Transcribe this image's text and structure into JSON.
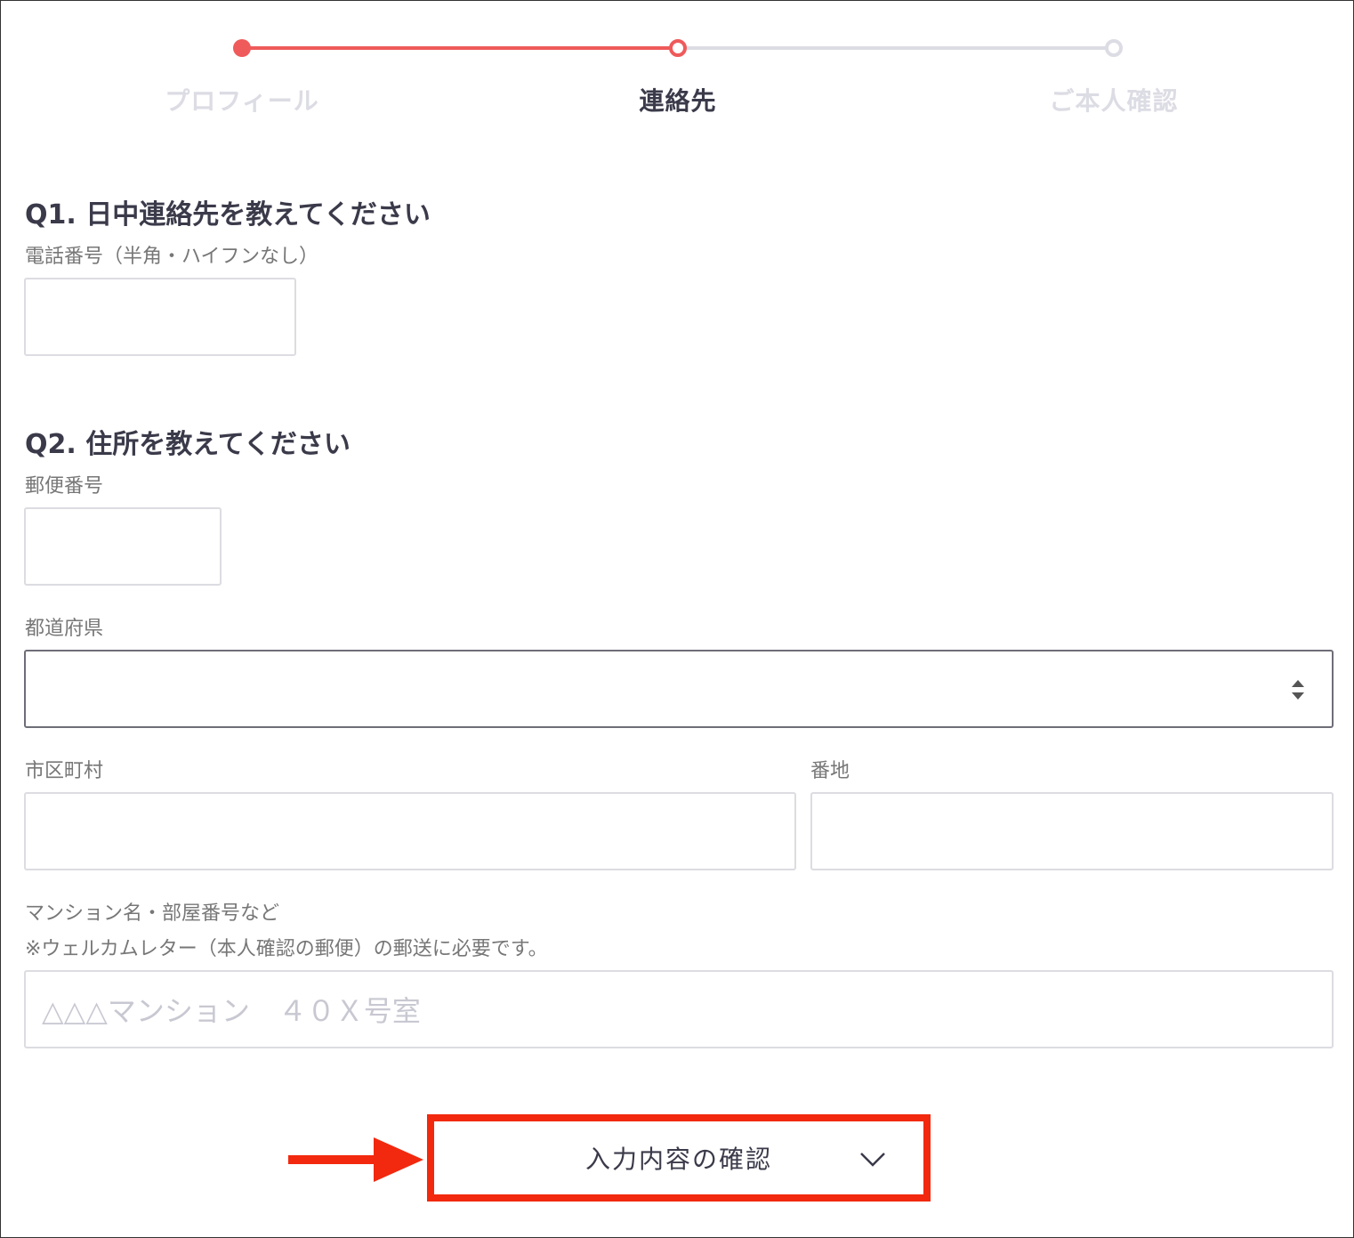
{
  "stepper": {
    "steps": [
      {
        "label": "プロフィール",
        "state": "done"
      },
      {
        "label": "連絡先",
        "state": "current"
      },
      {
        "label": "ご本人確認",
        "state": "upcoming"
      }
    ],
    "active_color": "#ef5a5a",
    "inactive_color": "#dcdce4"
  },
  "q1": {
    "title": "Q1. 日中連絡先を教えてください",
    "phone_label": "電話番号（半角・ハイフンなし）",
    "phone_value": ""
  },
  "q2": {
    "title": "Q2. 住所を教えてください",
    "postal_label": "郵便番号",
    "postal_value": "",
    "prefecture_label": "都道府県",
    "prefecture_value": "",
    "city_label": "市区町村",
    "city_value": "",
    "street_label": "番地",
    "street_value": "",
    "building_label": "マンション名・部屋番号など",
    "building_note": "※ウェルカムレター（本人確認の郵便）の郵送に必要です。",
    "building_placeholder": "△△△マンション　４０Ｘ号室"
  },
  "confirm": {
    "label": "入力内容の確認",
    "highlight_color": "#f2290e"
  },
  "icons": {
    "select": "updown-arrows-icon",
    "confirm": "chevron-down-icon",
    "annotation": "arrow-right-icon"
  }
}
